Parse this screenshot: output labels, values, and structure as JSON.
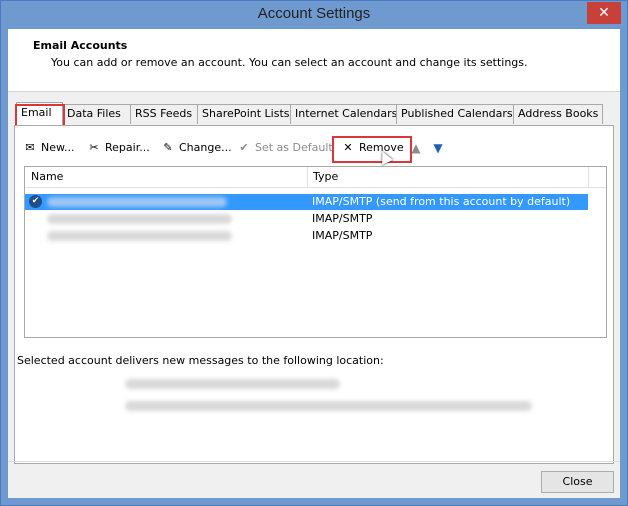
{
  "window": {
    "title": "Account Settings",
    "close_glyph": "✕"
  },
  "header": {
    "title": "Email Accounts",
    "description": "You can add or remove an account. You can select an account and change its settings."
  },
  "tabs": [
    {
      "label": "Email",
      "active": true
    },
    {
      "label": "Data Files"
    },
    {
      "label": "RSS Feeds"
    },
    {
      "label": "SharePoint Lists"
    },
    {
      "label": "Internet Calendars"
    },
    {
      "label": "Published Calendars"
    },
    {
      "label": "Address Books"
    }
  ],
  "toolbar": {
    "new_label": "New...",
    "repair_label": "Repair...",
    "change_label": "Change...",
    "set_default_label": "Set as Default",
    "remove_label": "Remove",
    "move_up_icon": "arrow-up-icon",
    "move_down_icon": "arrow-down-icon"
  },
  "list": {
    "columns": [
      "Name",
      "Type"
    ],
    "rows": [
      {
        "type": "IMAP/SMTP (send from this account by default)",
        "selected": true
      },
      {
        "type": "IMAP/SMTP"
      },
      {
        "type": "IMAP/SMTP"
      }
    ]
  },
  "delivery": {
    "label": "Selected account delivers new messages to the following location:"
  },
  "footer": {
    "close_label": "Close"
  },
  "colors": {
    "accent": "#3399ff",
    "highlight": "#d9363e",
    "title_bar": "#6f9ad0"
  }
}
